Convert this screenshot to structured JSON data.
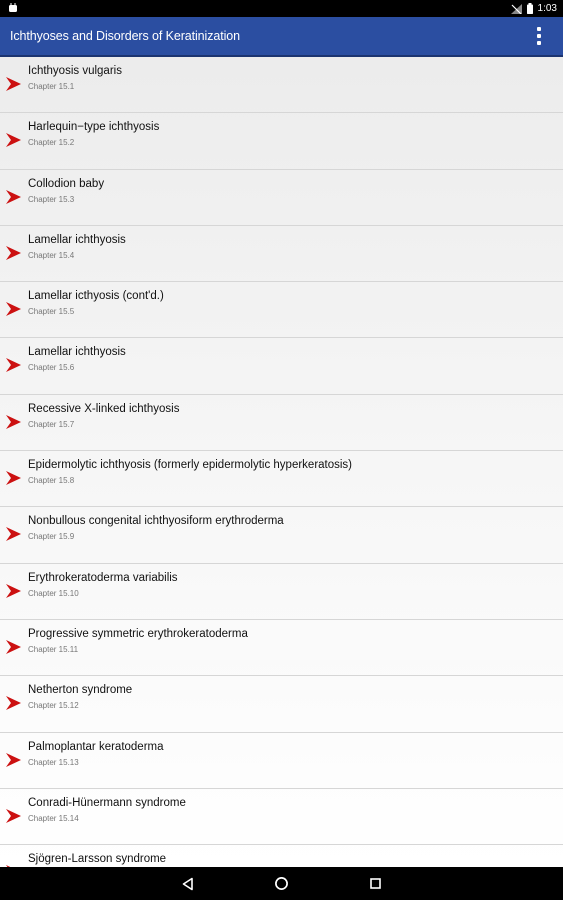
{
  "status_bar": {
    "time": "1:03",
    "icons": [
      "android-debug-icon",
      "no-signal-icon",
      "battery-icon"
    ]
  },
  "app_bar": {
    "title": "Ichthyoses and Disorders of Keratinization",
    "menu_icon": "overflow-menu-icon"
  },
  "chapters": [
    {
      "title": "Ichthyosis vulgaris",
      "chapter": "Chapter 15.1"
    },
    {
      "title": "Harlequin−type ichthyosis",
      "chapter": "Chapter 15.2"
    },
    {
      "title": "Collodion baby",
      "chapter": "Chapter 15.3"
    },
    {
      "title": "Lamellar ichthyosis",
      "chapter": "Chapter 15.4"
    },
    {
      "title": "Lamellar icthyosis (cont'd.)",
      "chapter": "Chapter 15.5"
    },
    {
      "title": "Lamellar ichthyosis",
      "chapter": "Chapter 15.6"
    },
    {
      "title": "Recessive X-linked ichthyosis",
      "chapter": "Chapter 15.7"
    },
    {
      "title": "Epidermolytic ichthyosis (formerly epidermolytic hyperkeratosis)",
      "chapter": "Chapter 15.8"
    },
    {
      "title": "Nonbullous congenital ichthyosiform erythroderma",
      "chapter": "Chapter 15.9"
    },
    {
      "title": "Erythrokeratoderma variabilis",
      "chapter": "Chapter 15.10"
    },
    {
      "title": "Progressive symmetric erythrokeratoderma",
      "chapter": "Chapter 15.11"
    },
    {
      "title": "Netherton syndrome",
      "chapter": "Chapter 15.12"
    },
    {
      "title": "Palmoplantar keratoderma",
      "chapter": "Chapter 15.13"
    },
    {
      "title": "Conradi-Hünermann syndrome",
      "chapter": "Chapter 15.14"
    },
    {
      "title": "Sjögren-Larsson syndrome",
      "chapter": ""
    }
  ],
  "nav_bar": {
    "icons": [
      "back-icon",
      "home-icon",
      "recents-icon"
    ]
  },
  "colors": {
    "app_bar": "#2b4ea1",
    "arrow": "#cc1111"
  }
}
